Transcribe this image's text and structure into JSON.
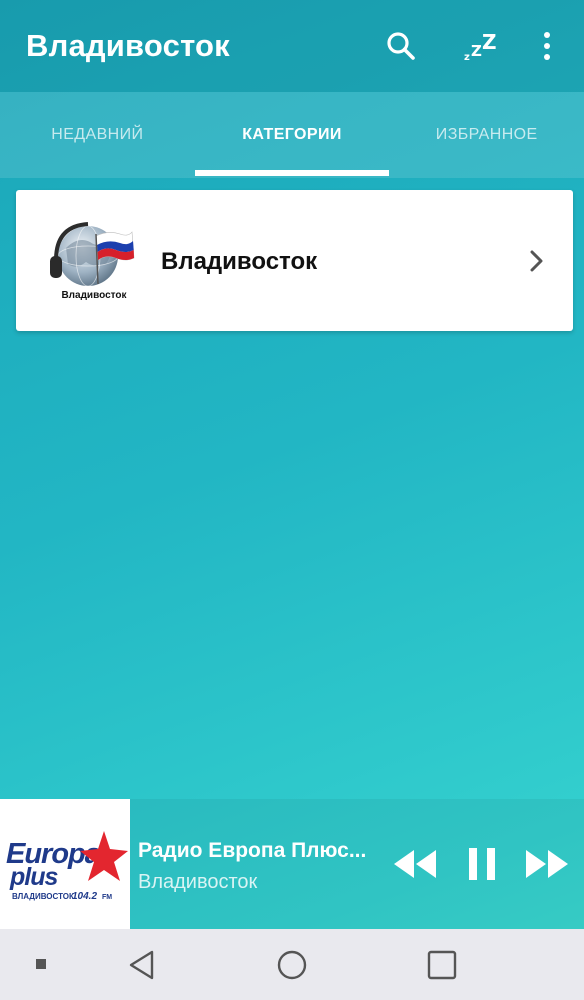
{
  "app_bar": {
    "title": "Владивосток",
    "icons": [
      "search-icon",
      "sleep-timer-icon",
      "more-vert-icon"
    ],
    "sleep_glyph": "zZZ"
  },
  "tabs": [
    {
      "label": "НЕДАВНИЙ",
      "active": false
    },
    {
      "label": "КАТЕГОРИИ",
      "active": true
    },
    {
      "label": "ИЗБРАННОЕ",
      "active": false
    }
  ],
  "categories": [
    {
      "title": "Владивосток",
      "logo_caption": "Владивосток",
      "icon": "chevron-right-icon"
    }
  ],
  "player": {
    "title": "Радио Европа Плюс...",
    "subtitle": "Владивосток",
    "art": {
      "brand_line1": "Europa",
      "brand_line2": "plus",
      "city": "ВЛАДИВОСТОК",
      "frequency": "104.2",
      "unit": "FM"
    },
    "controls": [
      "rewind-icon",
      "pause-icon",
      "fast-forward-icon"
    ]
  },
  "colors": {
    "gradient_start": "#1aa5b8",
    "gradient_end": "#3ddbd0",
    "card_bg": "#ffffff",
    "navbar_bg": "#e9e9ee",
    "brand_blue": "#1f3a8a",
    "brand_red": "#e3262f"
  },
  "navbar": {
    "buttons": [
      "menu-dot-icon",
      "back-icon",
      "home-icon",
      "recents-icon"
    ]
  }
}
